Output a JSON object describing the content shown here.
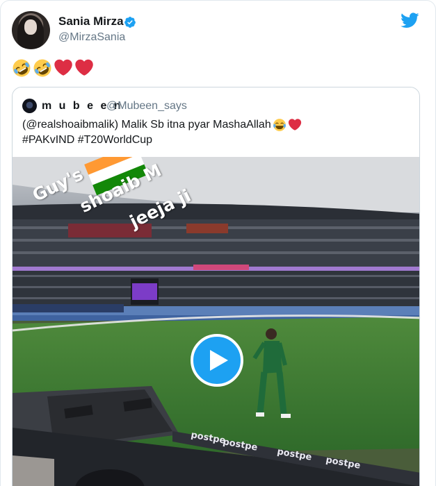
{
  "author": {
    "display_name": "Sania Mirza",
    "handle": "@MirzaSania",
    "verified": true
  },
  "tweet": {
    "emojis": [
      "rolling-on-floor-laughing",
      "rolling-on-floor-laughing",
      "red-heart",
      "red-heart"
    ]
  },
  "quoted_tweet": {
    "display_name": "m u b e e n",
    "handle": "@Mubeen_says",
    "text_line1": "(@realshoaibmalik) Malik Sb itna pyar MashaAllah",
    "text_line2": "#PAKvIND #T20WorldCup",
    "line1_emojis": [
      "face-with-tears-of-joy",
      "red-heart"
    ]
  },
  "video": {
    "overlay_words": [
      "Guy's",
      "shoaib M",
      "jeeja ji"
    ],
    "ad_board_text": "postpe"
  },
  "colors": {
    "twitter_blue": "#1da1f2",
    "handle_gray": "#657786",
    "heart_red": "#e0245e",
    "pitch_green": "#3f7a35"
  },
  "icons": [
    "twitter-bird-icon",
    "verified-badge-icon",
    "play-icon"
  ]
}
